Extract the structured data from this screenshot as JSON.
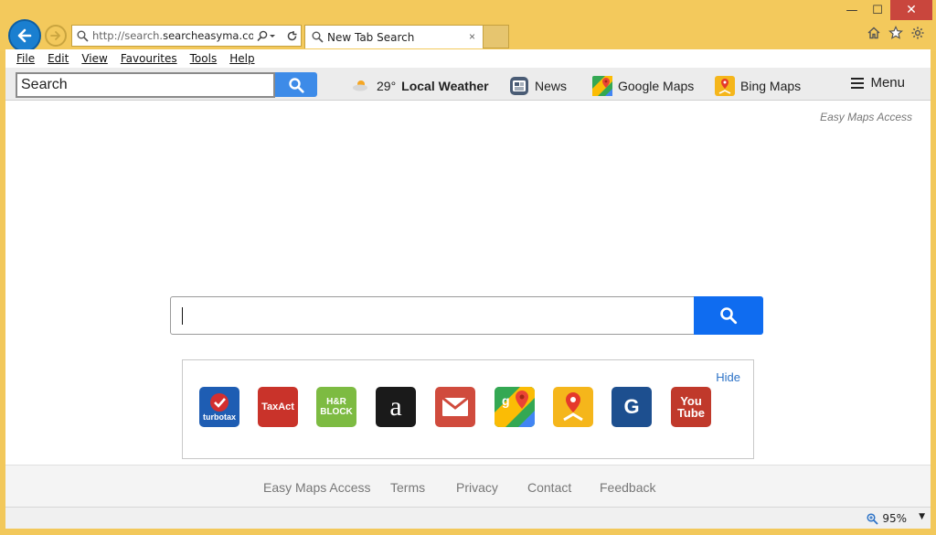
{
  "browser": {
    "address_url_prefix": "http://search.",
    "address_url_domain": "searcheasyma.com/",
    "tab_title": "New Tab Search",
    "tab_close": "×",
    "controls": {
      "minimize": "—",
      "maximize": "☐",
      "close": "✕"
    }
  },
  "menubar": [
    {
      "label": "File"
    },
    {
      "label": "Edit"
    },
    {
      "label": "View"
    },
    {
      "label": "Favourites"
    },
    {
      "label": "Tools"
    },
    {
      "label": "Help"
    }
  ],
  "site_toolbar": {
    "search_placeholder": "Search",
    "weather_temp": "29°",
    "weather_label": "Local Weather",
    "news": "News",
    "google_maps": "Google Maps",
    "bing_maps": "Bing Maps",
    "menu": "Menu"
  },
  "brand": "Easy Maps Access",
  "main_search": {
    "value": ""
  },
  "tiles": {
    "hide_label": "Hide",
    "items": [
      {
        "name": "turbotax",
        "text": "turbotax",
        "bg": "#1e5db3"
      },
      {
        "name": "taxact",
        "text": "TaxAct",
        "bg": "#c9332a"
      },
      {
        "name": "hr-block",
        "text": "H&R BLOCK",
        "bg": "#7dbb42"
      },
      {
        "name": "amazon",
        "text": "a",
        "bg": "#1a1a1a"
      },
      {
        "name": "gmail",
        "text": "✉",
        "bg": "#d04b3d"
      },
      {
        "name": "google-maps",
        "text": "g",
        "bg": "#34a853"
      },
      {
        "name": "bing-maps",
        "text": "",
        "bg": "#f5b61b"
      },
      {
        "name": "gogo",
        "text": "G",
        "bg": "#1d4f8f"
      },
      {
        "name": "youtube",
        "text": "You Tube",
        "bg": "#c0392b"
      }
    ]
  },
  "footer": [
    "Easy Maps Access",
    "Terms",
    "Privacy",
    "Contact",
    "Feedback"
  ],
  "status": {
    "zoom": "95%"
  },
  "colors": {
    "accent": "#0f6cf0",
    "frame": "#f3c95c",
    "link": "#2d73c7"
  }
}
